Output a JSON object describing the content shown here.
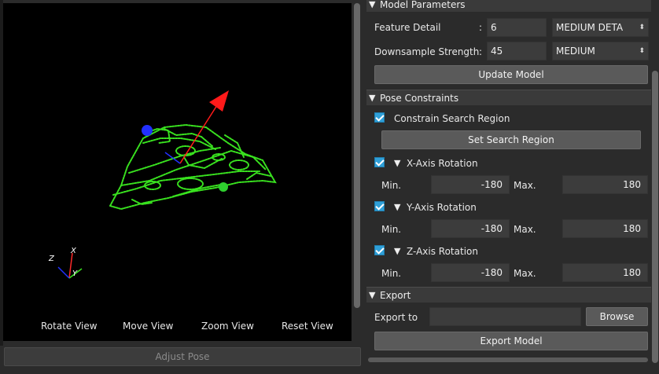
{
  "viewer": {
    "view_buttons": [
      {
        "label": "Rotate View"
      },
      {
        "label": "Move View"
      },
      {
        "label": "Zoom View"
      },
      {
        "label": "Reset View"
      }
    ],
    "axes": {
      "x": "X",
      "y": "Y",
      "z": "Z"
    },
    "adjust_pose_label": "Adjust Pose",
    "colors": {
      "point_cloud": "#39e21f",
      "pose_arrow": "#ff1a1a",
      "marker": "#2230ff"
    }
  },
  "model_parameters": {
    "title": "Model Parameters",
    "feature_detail": {
      "label": "Feature Detail",
      "sep": ":",
      "value": "6",
      "preset": "MEDIUM DETA"
    },
    "downsample_strength": {
      "label": "Downsample Strength",
      "sep": ":",
      "value": "45",
      "preset": "MEDIUM"
    },
    "update_button": "Update Model"
  },
  "pose_constraints": {
    "title": "Pose Constraints",
    "constrain_search_region": {
      "label": "Constrain Search Region",
      "checked": true
    },
    "set_region_button": "Set Search Region",
    "rotations": [
      {
        "label": "X-Axis Rotation",
        "checked": true,
        "min_label": "Min.",
        "min": "-180",
        "max_label": "Max.",
        "max": "180"
      },
      {
        "label": "Y-Axis Rotation",
        "checked": true,
        "min_label": "Min.",
        "min": "-180",
        "max_label": "Max.",
        "max": "180"
      },
      {
        "label": "Z-Axis Rotation",
        "checked": true,
        "min_label": "Min.",
        "min": "-180",
        "max_label": "Max.",
        "max": "180"
      }
    ]
  },
  "export": {
    "title": "Export",
    "export_to_label": "Export to",
    "path_value": "",
    "browse_button": "Browse",
    "export_button": "Export Model"
  },
  "icons": {
    "expanded": "triangle-down-icon",
    "dropdown": "chevron-updown-icon",
    "check": "checkmark-icon"
  }
}
